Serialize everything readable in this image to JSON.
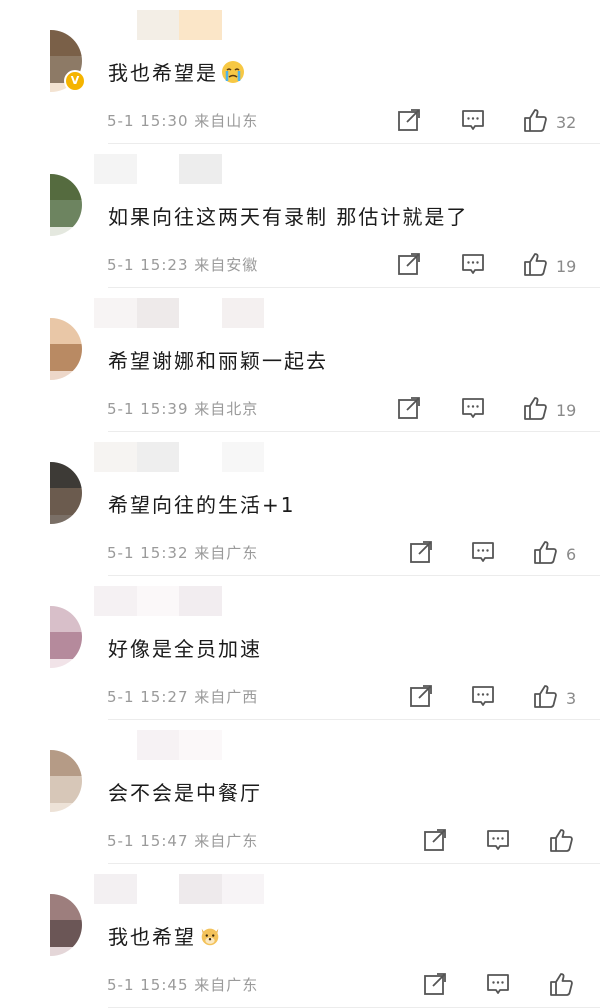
{
  "comments": [
    {
      "text": "我也希望是",
      "emoji": "crying-face-icon",
      "time": "5-1 15:30",
      "location": "来自山东",
      "likes": "32",
      "vip": true,
      "mosaic": [
        "#7a6048",
        "#e9d8c7",
        "#8d7a66",
        "#dfcbb7",
        "#f3e3d2",
        "#f8f2ea",
        "#efe2d6",
        "#fbf6f0"
      ],
      "nameBlur": [
        "#ffffff",
        "#f3eee6",
        "#fbe6c8",
        "#ffffff"
      ]
    },
    {
      "text": "如果向往这两天有录制 那估计就是了",
      "time": "5-1 15:23",
      "location": "来自安徽",
      "likes": "19",
      "vip": false,
      "mosaic": [
        "#556b3f",
        "#99b08b",
        "#6d8460",
        "#c8d0c0",
        "#e4e8df",
        "#f5f6f2",
        "#eef0ea",
        "#ffffff"
      ],
      "nameBlur": [
        "#f4f4f4",
        "#ffffff",
        "#ededed",
        "#ffffff"
      ]
    },
    {
      "text": "希望谢娜和丽颖一起去",
      "time": "5-1 15:39",
      "location": "来自北京",
      "likes": "19",
      "vip": false,
      "mosaic": [
        "#e9c7a7",
        "#f1dccc",
        "#b98a63",
        "#f4e1d2",
        "#edd7c9",
        "#f7ece3",
        "#f3e5dc",
        "#fbf4ef"
      ],
      "nameBlur": [
        "#f7f4f4",
        "#eeeaea",
        "#ffffff",
        "#f4f0f0"
      ]
    },
    {
      "text": "希望向往的生活+1",
      "time": "5-1 15:32",
      "location": "来自广东",
      "likes": "6",
      "vip": false,
      "mosaic": [
        "#3d3a36",
        "#cfc9c2",
        "#6b5b4e",
        "#e2d9cf",
        "#7a6f66",
        "#f4ead9",
        "#9c948c",
        "#fbf1dd"
      ],
      "nameBlur": [
        "#f6f4f2",
        "#eeeeee",
        "#ffffff",
        "#f7f7f7"
      ]
    },
    {
      "text": "好像是全员加速",
      "time": "5-1 15:27",
      "location": "来自广西",
      "likes": "3",
      "vip": false,
      "mosaic": [
        "#d8bfc9",
        "#e7d8de",
        "#b58a9c",
        "#cbb2bd",
        "#f1e3e8",
        "#f7eef1",
        "#f4ecef",
        "#fbf7f9"
      ],
      "nameBlur": [
        "#f5f1f3",
        "#fbf8f9",
        "#f2edf0",
        "#ffffff"
      ]
    },
    {
      "text": "会不会是中餐厅",
      "time": "5-1 15:47",
      "location": "来自广东",
      "likes": "",
      "vip": false,
      "mosaic": [
        "#b59b86",
        "#5e5a55",
        "#d7c7b8",
        "#8d8a86",
        "#ede2d7",
        "#c9c6c2",
        "#f6f0ea",
        "#eeeeee"
      ],
      "nameBlur": [
        "#ffffff",
        "#f6f2f4",
        "#fbf8f9",
        "#ffffff"
      ]
    },
    {
      "text": "我也希望",
      "emoji": "dog-face-icon",
      "time": "5-1 15:45",
      "location": "来自广东",
      "likes": "",
      "vip": false,
      "mosaic": [
        "#9d7e7d",
        "#d9c5c8",
        "#6b5656",
        "#cbb3b7",
        "#e4d6d8",
        "#f5eced",
        "#f0e8e9",
        "#fbf6f7"
      ],
      "nameBlur": [
        "#f3f0f2",
        "#ffffff",
        "#eeeaec",
        "#f7f4f6"
      ]
    }
  ]
}
